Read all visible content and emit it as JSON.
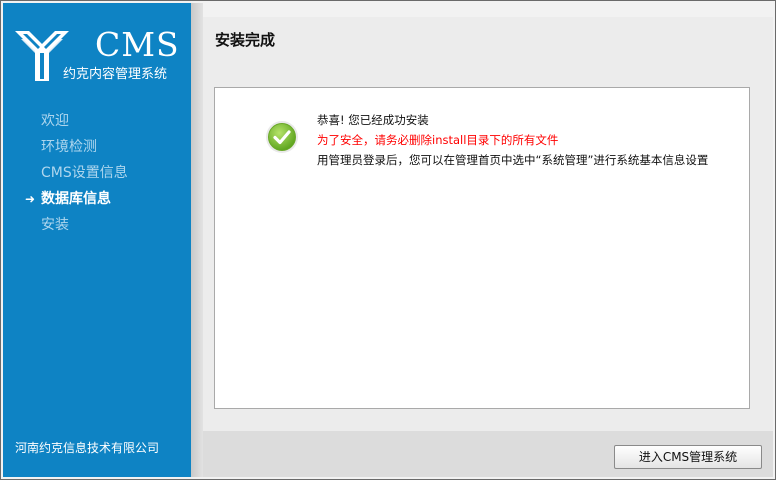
{
  "brand": {
    "logo_text": "CMS",
    "subtitle": "约克内容管理系统",
    "company": "河南约克信息技术有限公司"
  },
  "steps": [
    {
      "label": "欢迎",
      "active": false
    },
    {
      "label": "环境检测",
      "active": false
    },
    {
      "label": "CMS设置信息",
      "active": false
    },
    {
      "label": "数据库信息",
      "active": true
    },
    {
      "label": "安装",
      "active": false
    }
  ],
  "main": {
    "title": "安装完成",
    "messages": [
      "恭喜! 您已经成功安装",
      "为了安全，请务必删除install目录下的所有文件",
      "用管理员登录后，您可以在管理首页中选中“系统管理”进行系统基本信息设置"
    ]
  },
  "footer": {
    "enter_button": "进入CMS管理系统"
  },
  "icons": {
    "success": "check-circle-icon",
    "step_arrow": "arrow-right-icon"
  },
  "colors": {
    "sidebar": "#0e83c4",
    "success_green": "#7cc23a",
    "warning_red": "#ff0000"
  }
}
